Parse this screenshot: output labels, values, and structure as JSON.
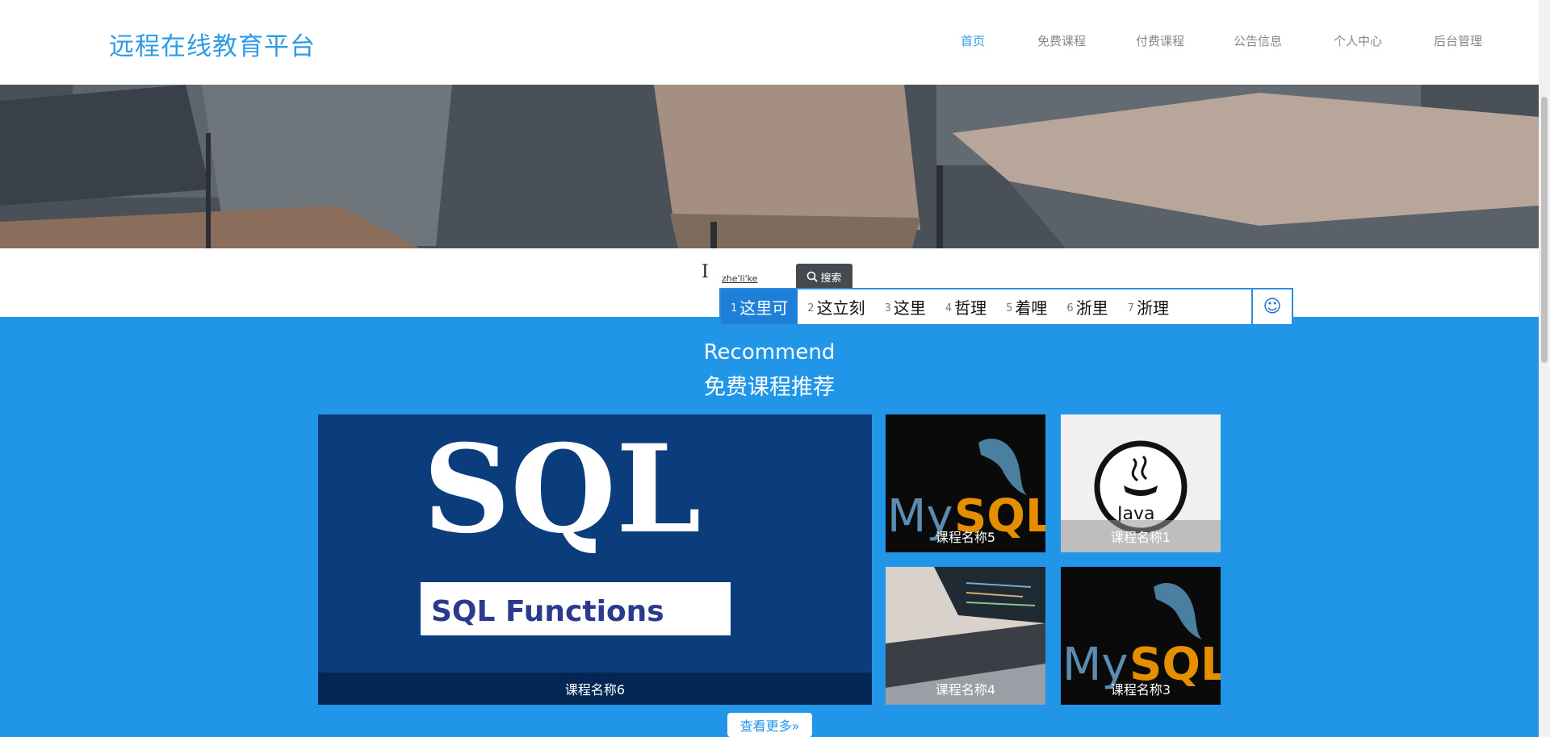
{
  "header": {
    "logo": "远程在线教育平台",
    "nav": [
      {
        "label": "首页",
        "active": true
      },
      {
        "label": "免费课程",
        "active": false
      },
      {
        "label": "付费课程",
        "active": false
      },
      {
        "label": "公告信息",
        "active": false
      },
      {
        "label": "个人中心",
        "active": false
      },
      {
        "label": "后台管理",
        "active": false
      }
    ]
  },
  "search": {
    "value": "zhe'li'ke",
    "button_label": "搜索",
    "button_icon": "search-icon"
  },
  "ime": {
    "candidates": [
      {
        "num": "1",
        "text": "这里可"
      },
      {
        "num": "2",
        "text": "这立刻"
      },
      {
        "num": "3",
        "text": "这里"
      },
      {
        "num": "4",
        "text": "哲理"
      },
      {
        "num": "5",
        "text": "着哩"
      },
      {
        "num": "6",
        "text": "浙里"
      },
      {
        "num": "7",
        "text": "浙理"
      }
    ],
    "selected_index": 0,
    "emoji_glyph": "☺"
  },
  "recommend": {
    "title_en": "Recommend",
    "title_cn": "免费课程推荐",
    "courses": [
      {
        "name": "课程名称6",
        "image": "sql-functions-cover",
        "image_title": "SQL",
        "image_subtitle": "SQL Functions"
      },
      {
        "name": "课程名称5",
        "image": "mysql-logo-dark"
      },
      {
        "name": "课程名称1",
        "image": "java-logo-light"
      },
      {
        "name": "课程名称4",
        "image": "laptop-keyboard-photo"
      },
      {
        "name": "课程名称3",
        "image": "mysql-logo-dark"
      }
    ],
    "more_label": "查看更多»"
  },
  "colors": {
    "brand": "#2e9be6",
    "section_bg": "#2196e8",
    "ime_highlight": "#1e7fd9"
  }
}
